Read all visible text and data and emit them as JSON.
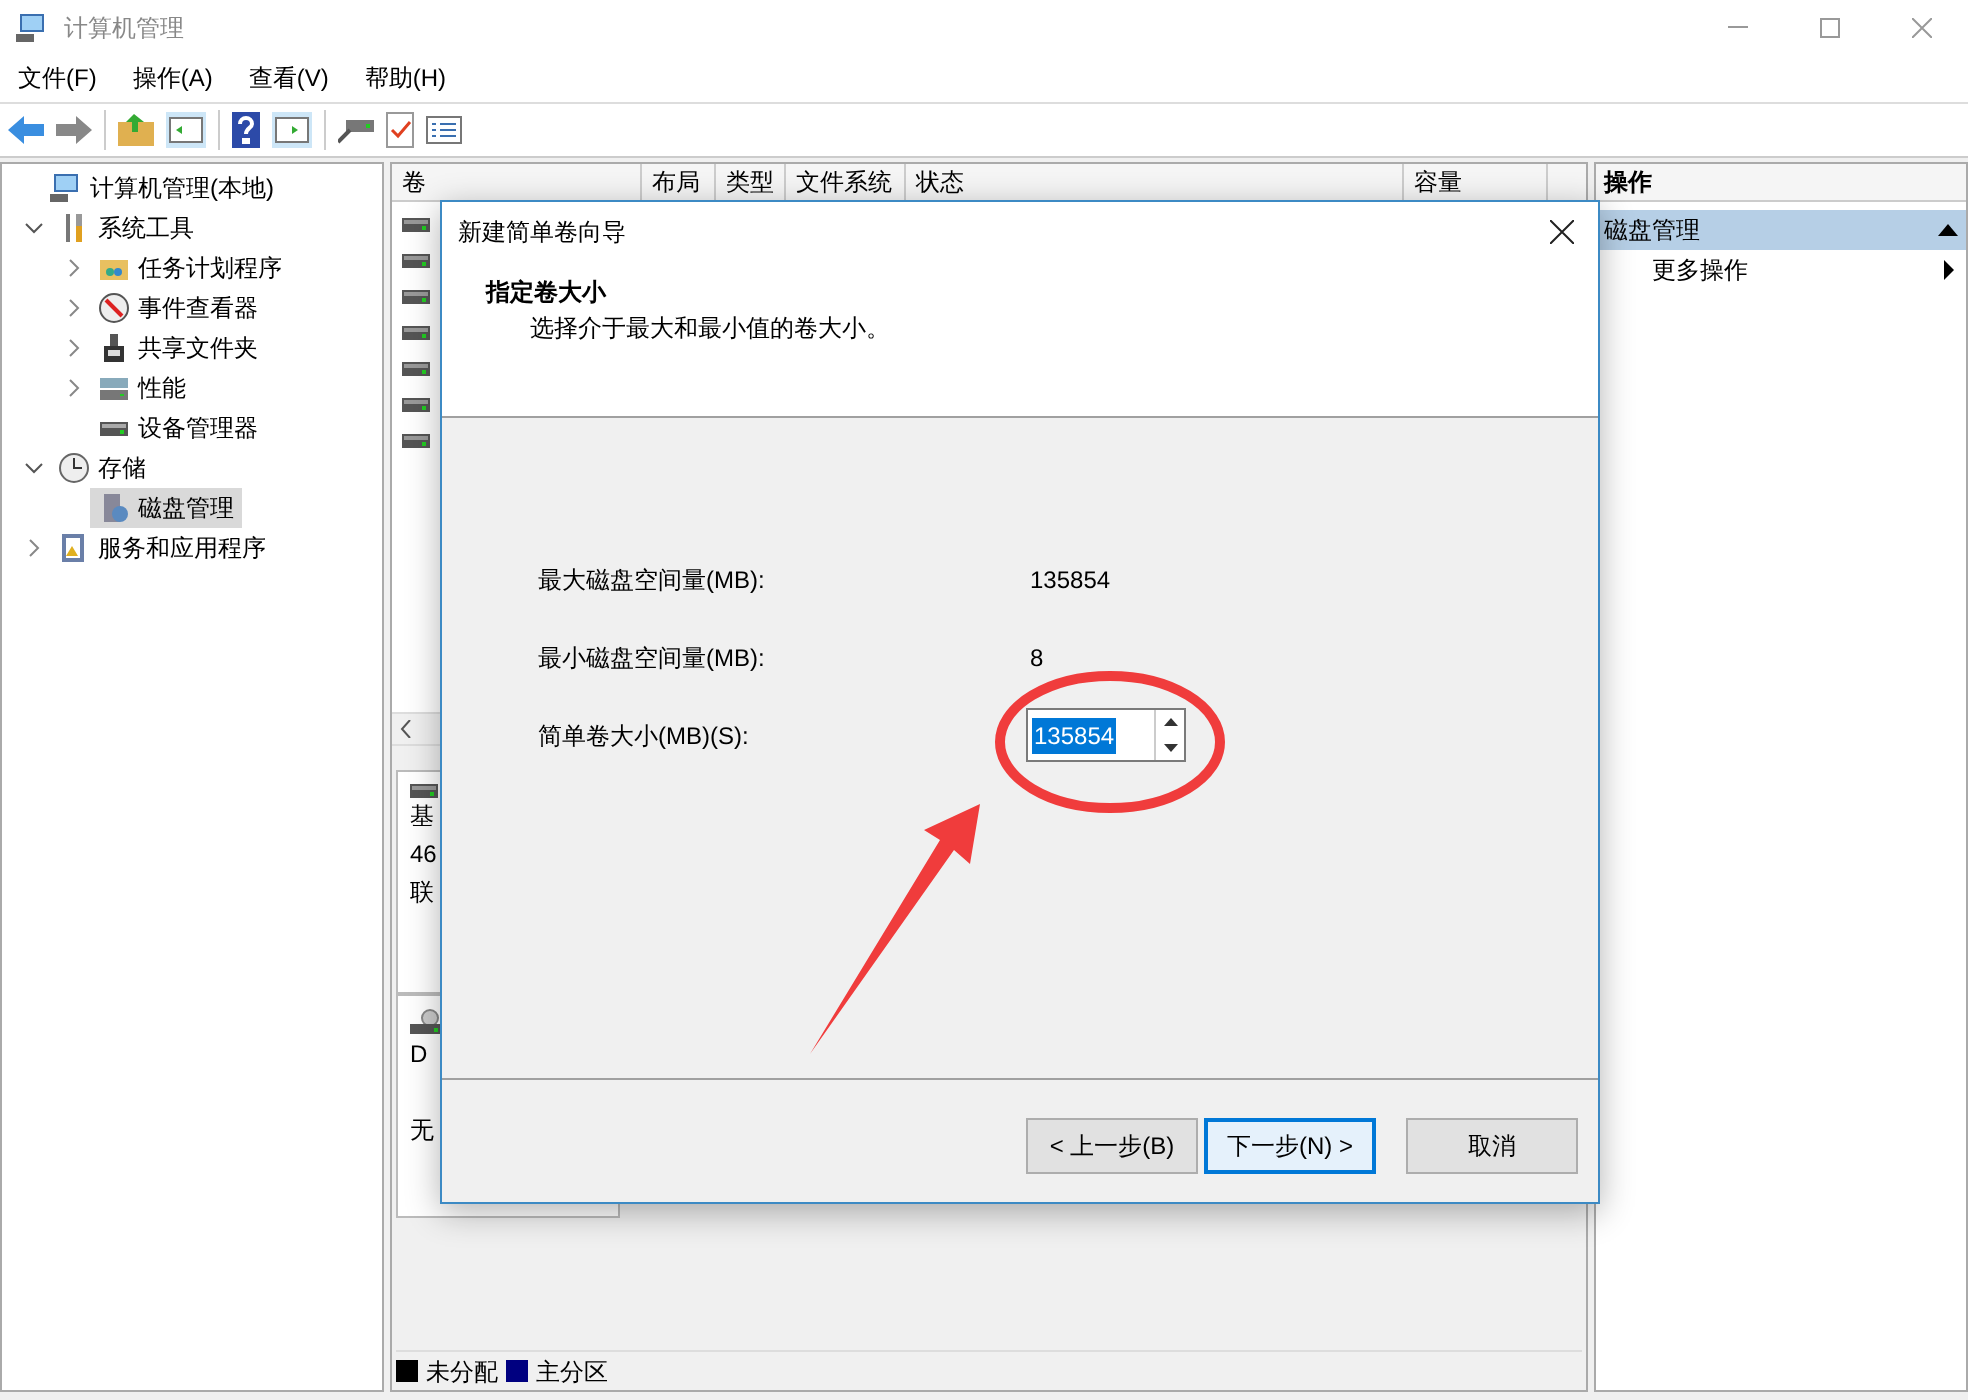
{
  "window": {
    "title": "计算机管理"
  },
  "menu": [
    "文件(F)",
    "操作(A)",
    "查看(V)",
    "帮助(H)"
  ],
  "tree": [
    {
      "label": "计算机管理(本地)",
      "selected": false,
      "children": [
        {
          "label": "系统工具",
          "expanded": true,
          "selected": false,
          "children": [
            {
              "label": "任务计划程序",
              "expanded": false,
              "selected": false
            },
            {
              "label": "事件查看器",
              "expanded": false,
              "selected": false
            },
            {
              "label": "共享文件夹",
              "expanded": false,
              "selected": false
            },
            {
              "label": "性能",
              "expanded": false,
              "selected": false
            },
            {
              "label": "设备管理器",
              "selected": false
            }
          ]
        },
        {
          "label": "存储",
          "expanded": true,
          "selected": false,
          "children": [
            {
              "label": "磁盘管理",
              "selected": true
            }
          ]
        },
        {
          "label": "服务和应用程序",
          "expanded": false,
          "selected": false
        }
      ]
    }
  ],
  "columns": [
    "卷",
    "布局",
    "类型",
    "文件系统",
    "状态",
    "容量"
  ],
  "volumes": [
    {
      "kind": "volume"
    },
    {
      "kind": "volume"
    },
    {
      "kind": "volume"
    },
    {
      "kind": "volume"
    },
    {
      "kind": "volume"
    },
    {
      "kind": "volume"
    },
    {
      "kind": "volume"
    }
  ],
  "disks": [
    {
      "kind": "disk",
      "lines": [
        "基",
        "46",
        "联"
      ]
    },
    {
      "kind": "dvd",
      "lines": [
        "D",
        "无"
      ]
    }
  ],
  "legend": [
    {
      "label": "未分配",
      "color": "#000000"
    },
    {
      "label": "主分区",
      "color": "#000080"
    }
  ],
  "actions": {
    "title": "操作",
    "items": [
      {
        "label": "磁盘管理",
        "kind": "section"
      },
      {
        "label": "更多操作",
        "kind": "submenu"
      }
    ]
  },
  "dialog": {
    "title": "新建简单卷向导",
    "heading": "指定卷大小",
    "subtitle": "选择介于最大和最小值的卷大小。",
    "fields": [
      {
        "kind": "text",
        "label": "最大磁盘空间量(MB):",
        "value": "135854"
      },
      {
        "kind": "text",
        "label": "最小磁盘空间量(MB):",
        "value": "8"
      },
      {
        "kind": "spin",
        "label": "简单卷大小(MB)(S):",
        "value": "135854",
        "highlighted": true
      }
    ],
    "buttons": [
      {
        "label": "< 上一步(B)",
        "focused": false
      },
      {
        "label": "下一步(N) >",
        "focused": true
      },
      {
        "label": "取消",
        "focused": false
      }
    ]
  }
}
